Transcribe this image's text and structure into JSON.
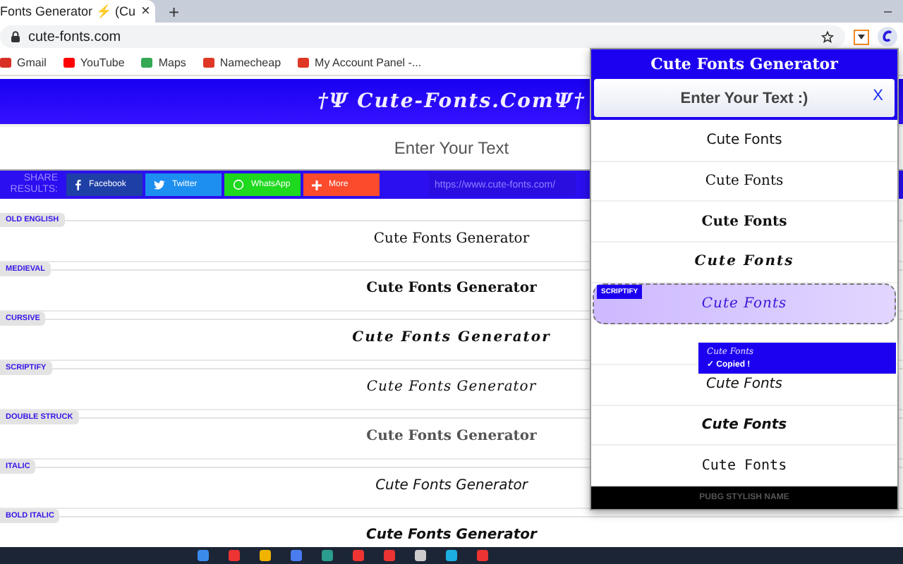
{
  "browser": {
    "tab_title": "Fonts Generator ⚡ (Cu",
    "tab_close": "×",
    "new_tab": "+",
    "minimize": "–",
    "url": "cute-fonts.com",
    "bookmarks": [
      {
        "label": "Gmail",
        "color": "#d93025"
      },
      {
        "label": "YouTube",
        "color": "#ff0000"
      },
      {
        "label": "Maps",
        "color": "#34a853"
      },
      {
        "label": "Namecheap",
        "color": "#de3723"
      },
      {
        "label": "My Account Panel -...",
        "color": "#de3723"
      }
    ]
  },
  "site": {
    "title": "†Ψ Cute-Fonts.ComΨ†",
    "input_placeholder": "Enter Your Text",
    "share_label": "SHARE RESULTS:",
    "share_buttons": [
      {
        "label": "Facebook",
        "kind": "facebook",
        "color": "#1e3fa6"
      },
      {
        "label": "Twitter",
        "kind": "twitter",
        "color": "#1d8ff0"
      },
      {
        "label": "WhatsApp",
        "kind": "whatsapp",
        "color": "#1ed91e"
      },
      {
        "label": "More",
        "kind": "more",
        "color": "#fb4a2c"
      }
    ],
    "share_url": "https://www.cute-fonts.com/",
    "styles": [
      {
        "label": "OLD ENGLISH",
        "text": "Cute Fonts Generator",
        "kind": "blackletter"
      },
      {
        "label": "MEDIEVAL",
        "text": "Cute Fonts Generator",
        "kind": "medieval"
      },
      {
        "label": "CURSIVE",
        "text": "Cute Fonts Generator",
        "kind": "cursive"
      },
      {
        "label": "SCRIPTIFY",
        "text": "Cute Fonts Generator",
        "kind": "script"
      },
      {
        "label": "DOUBLE STRUCK",
        "text": "Cute Fonts Generator",
        "kind": "double"
      },
      {
        "label": "ITALIC",
        "text": "Cute Fonts Generator",
        "kind": "italic"
      },
      {
        "label": "BOLD ITALIC",
        "text": "Cute Fonts Generator",
        "kind": "bolditalic"
      }
    ]
  },
  "popup": {
    "title": "Cute Fonts Generator",
    "input_placeholder": "Enter Your Text :)",
    "clear": "X",
    "results": [
      {
        "text": "Cute Fonts",
        "kind": "plain",
        "selected": false
      },
      {
        "text": "Cute Fonts",
        "kind": "blackletter",
        "selected": false
      },
      {
        "text": "Cute Fonts",
        "kind": "medieval",
        "selected": false
      },
      {
        "text": "Cute Fonts",
        "kind": "cursive",
        "selected": false
      },
      {
        "text": "Cute Fonts",
        "kind": "script",
        "selected": true,
        "tag": "SCRIPTIFY"
      },
      {
        "selected": false
      },
      {
        "text": "Cute Fonts",
        "kind": "italic",
        "selected": false
      },
      {
        "text": "Cute Fonts",
        "kind": "bolditalic",
        "selected": false
      },
      {
        "text": "Cute Fonts",
        "kind": "mono",
        "selected": false
      }
    ],
    "toast": {
      "text": "Cute Fonts",
      "status": "✓ Copied !"
    },
    "footer": "PUBG STYLISH NAME"
  }
}
